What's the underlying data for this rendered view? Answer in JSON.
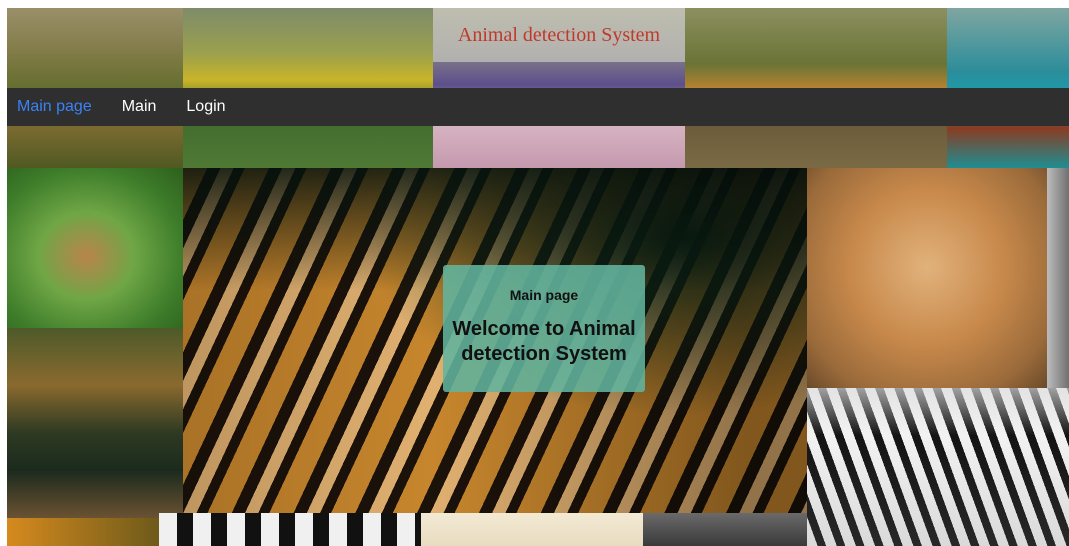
{
  "header": {
    "title": "Animal detection System"
  },
  "nav": {
    "items": [
      "Main page",
      "Main",
      "Login"
    ],
    "active_index": 0,
    "active_color": "#3b82f6"
  },
  "card": {
    "subtitle": "Main page",
    "heading": "Welcome to Animal detection System",
    "background": "#62b49e"
  },
  "colors": {
    "title_text": "#c0392b",
    "navbar_bg": "#2f2f2f"
  }
}
